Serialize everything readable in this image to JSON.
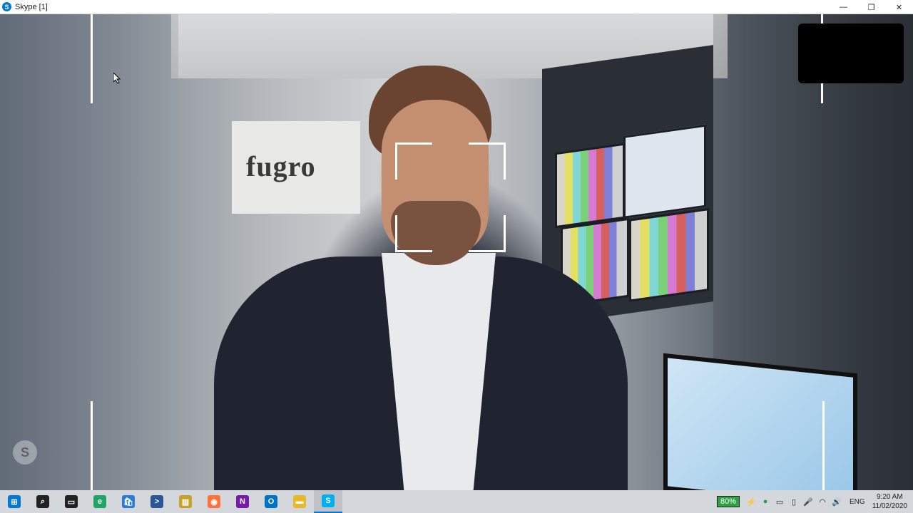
{
  "window": {
    "title": "Skype [1]",
    "app_icon": "skype-icon",
    "controls": {
      "minimize": "—",
      "restore": "❐",
      "close": "✕"
    }
  },
  "video": {
    "logo_text": "fugro",
    "watermark_icon": "skype-watermark-icon",
    "watermark_letter": "S"
  },
  "taskbar": {
    "items": [
      {
        "name": "start-icon",
        "glyph": "⊞",
        "color": "#0078d4"
      },
      {
        "name": "search-icon",
        "glyph": "⌕",
        "color": "#222222"
      },
      {
        "name": "task-view-icon",
        "glyph": "▭",
        "color": "#222222"
      },
      {
        "name": "edge-icon",
        "glyph": "e",
        "color": "#1fa463"
      },
      {
        "name": "store-icon",
        "glyph": "🛍",
        "color": "#2b7bd6"
      },
      {
        "name": "powershell-icon",
        "glyph": ">",
        "color": "#2b5797"
      },
      {
        "name": "library-icon",
        "glyph": "▥",
        "color": "#c8a227"
      },
      {
        "name": "firefox-icon",
        "glyph": "◉",
        "color": "#ff7139"
      },
      {
        "name": "onenote-icon",
        "glyph": "N",
        "color": "#7719aa"
      },
      {
        "name": "outlook-icon",
        "glyph": "O",
        "color": "#0072c6"
      },
      {
        "name": "file-explorer-icon",
        "glyph": "▬",
        "color": "#e8b828"
      },
      {
        "name": "skype-taskbar-icon",
        "glyph": "S",
        "color": "#00aff0"
      }
    ],
    "battery": "80%",
    "tray_icons": [
      "power-icon",
      "security-icon",
      "network-device-icon",
      "usb-icon",
      "microphone-icon",
      "wifi-icon",
      "volume-icon"
    ],
    "language": "ENG",
    "time": "9:20 AM",
    "date": "11/02/2020"
  }
}
